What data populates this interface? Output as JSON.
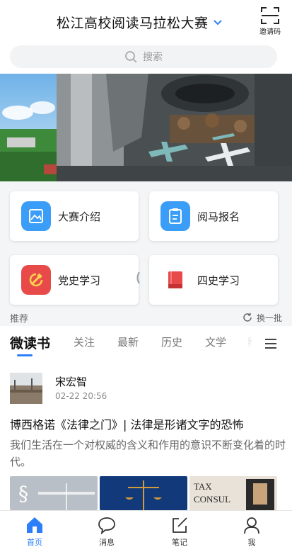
{
  "header": {
    "title": "松江高校阅读马拉松大赛",
    "scan_label": "邀请码"
  },
  "search": {
    "placeholder": "搜索"
  },
  "entries": [
    {
      "label": "大赛介绍",
      "icon": "image-icon",
      "color": "#3a9df8"
    },
    {
      "label": "阅马报名",
      "icon": "clipboard-icon",
      "color": "#3a9df8"
    },
    {
      "label": "党史学习",
      "icon": "party-emblem-icon",
      "color": "#e84a4a"
    },
    {
      "label": "四史学习",
      "icon": "book-icon",
      "color": "#e84a4a"
    }
  ],
  "recommend": {
    "label": "推荐",
    "refresh_label": "换一批"
  },
  "tabs": [
    "微读书",
    "关注",
    "最新",
    "历史",
    "文学",
    "科"
  ],
  "post": {
    "author": "宋宏智",
    "time": "02-22 20:56",
    "title": "博西格诺《法律之门》| 法律是形诸文字的恐怖",
    "description": "我们生活在一个对权威的含义和作用的意识不断变化着的时代。",
    "image_texts": {
      "third": "TAX CONSUL"
    }
  },
  "nav": [
    {
      "label": "首页",
      "active": true
    },
    {
      "label": "消息",
      "active": false
    },
    {
      "label": "笔记",
      "active": false
    },
    {
      "label": "我",
      "active": false
    }
  ],
  "colors": {
    "accent": "#2d7ff9",
    "entry_blue": "#3a9df8",
    "entry_red": "#e84a4a"
  }
}
